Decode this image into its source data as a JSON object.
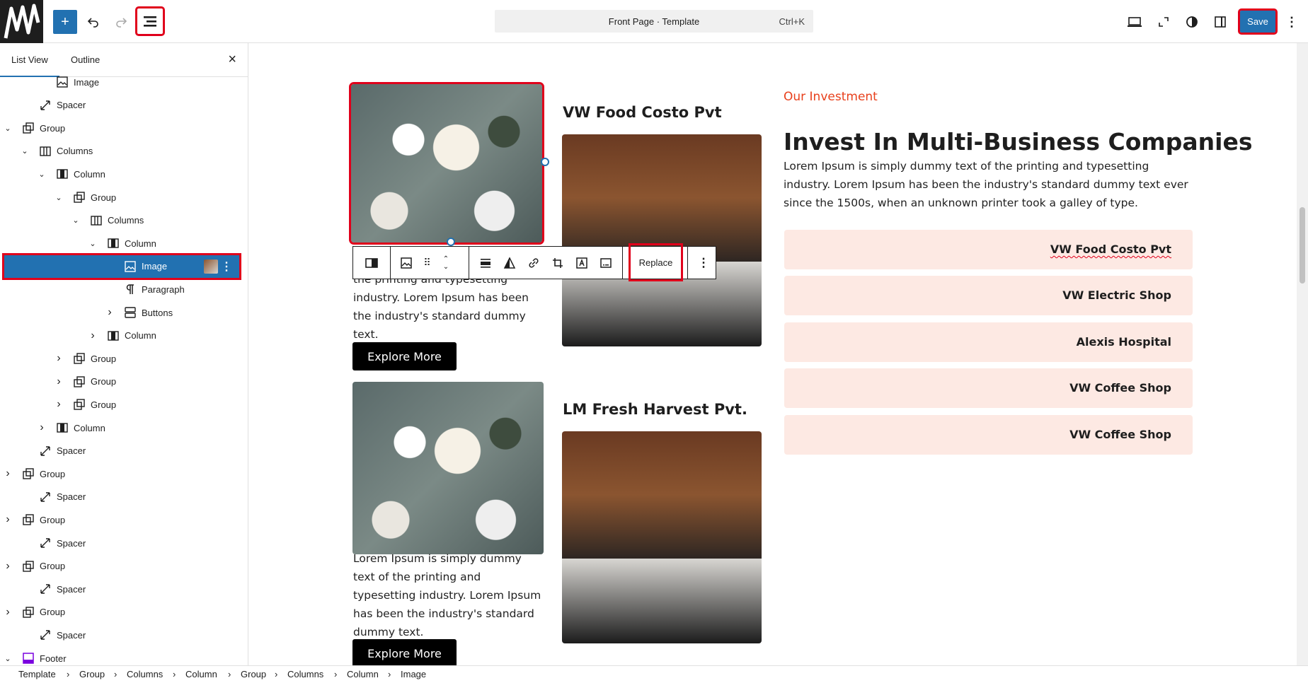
{
  "topbar": {
    "command_title": "Front Page · Template",
    "command_shortcut": "Ctrl+K",
    "save_label": "Save"
  },
  "sidebar": {
    "tabs": [
      "List View",
      "Outline"
    ],
    "items": [
      {
        "label": "Image",
        "icon": "image-icon"
      },
      {
        "label": "Spacer",
        "icon": "spacer-icon"
      },
      {
        "label": "Group",
        "icon": "group-icon"
      },
      {
        "label": "Columns",
        "icon": "columns-icon"
      },
      {
        "label": "Column",
        "icon": "column-icon"
      },
      {
        "label": "Group",
        "icon": "group-icon"
      },
      {
        "label": "Columns",
        "icon": "columns-icon"
      },
      {
        "label": "Column",
        "icon": "column-icon"
      },
      {
        "label": "Image",
        "icon": "image-icon"
      },
      {
        "label": "Paragraph",
        "icon": "paragraph-icon"
      },
      {
        "label": "Buttons",
        "icon": "buttons-icon"
      },
      {
        "label": "Column",
        "icon": "column-icon"
      },
      {
        "label": "Group",
        "icon": "group-icon"
      },
      {
        "label": "Group",
        "icon": "group-icon"
      },
      {
        "label": "Group",
        "icon": "group-icon"
      },
      {
        "label": "Column",
        "icon": "column-icon"
      },
      {
        "label": "Spacer",
        "icon": "spacer-icon"
      },
      {
        "label": "Group",
        "icon": "group-icon"
      },
      {
        "label": "Spacer",
        "icon": "spacer-icon"
      },
      {
        "label": "Group",
        "icon": "group-icon"
      },
      {
        "label": "Spacer",
        "icon": "spacer-icon"
      },
      {
        "label": "Group",
        "icon": "group-icon"
      },
      {
        "label": "Spacer",
        "icon": "spacer-icon"
      },
      {
        "label": "Group",
        "icon": "group-icon"
      },
      {
        "label": "Spacer",
        "icon": "spacer-icon"
      },
      {
        "label": "Footer",
        "icon": "footer-icon"
      }
    ]
  },
  "block_toolbar": {
    "replace_label": "Replace"
  },
  "content": {
    "card1_title": "VW Food Costo Pvt",
    "card1_text": "the printing and typesetting industry. Lorem Ipsum has been the industry's standard dummy text.",
    "card1_button": "Explore More",
    "card2_title": "LM Fresh Harvest Pvt.",
    "card2_text": "Lorem Ipsum is simply dummy text of the printing and typesetting industry. Lorem Ipsum has been the industry's standard dummy text.",
    "card2_button": "Explore More",
    "eyebrow": "Our Investment",
    "heading": "Invest In Multi-Business Companies",
    "body": "Lorem Ipsum is simply dummy text of the printing and typesetting industry. Lorem Ipsum has been the industry's standard dummy text ever since the 1500s, when an unknown printer took a galley of type.",
    "companies": [
      "VW Food Costo Pvt",
      "VW Electric Shop",
      "Alexis Hospital",
      "VW Coffee Shop",
      "VW Coffee Shop"
    ],
    "accent_color": "#e8401c"
  },
  "breadcrumb": [
    "Template",
    "Group",
    "Columns",
    "Column",
    "Group",
    "Columns",
    "Column",
    "Image"
  ]
}
